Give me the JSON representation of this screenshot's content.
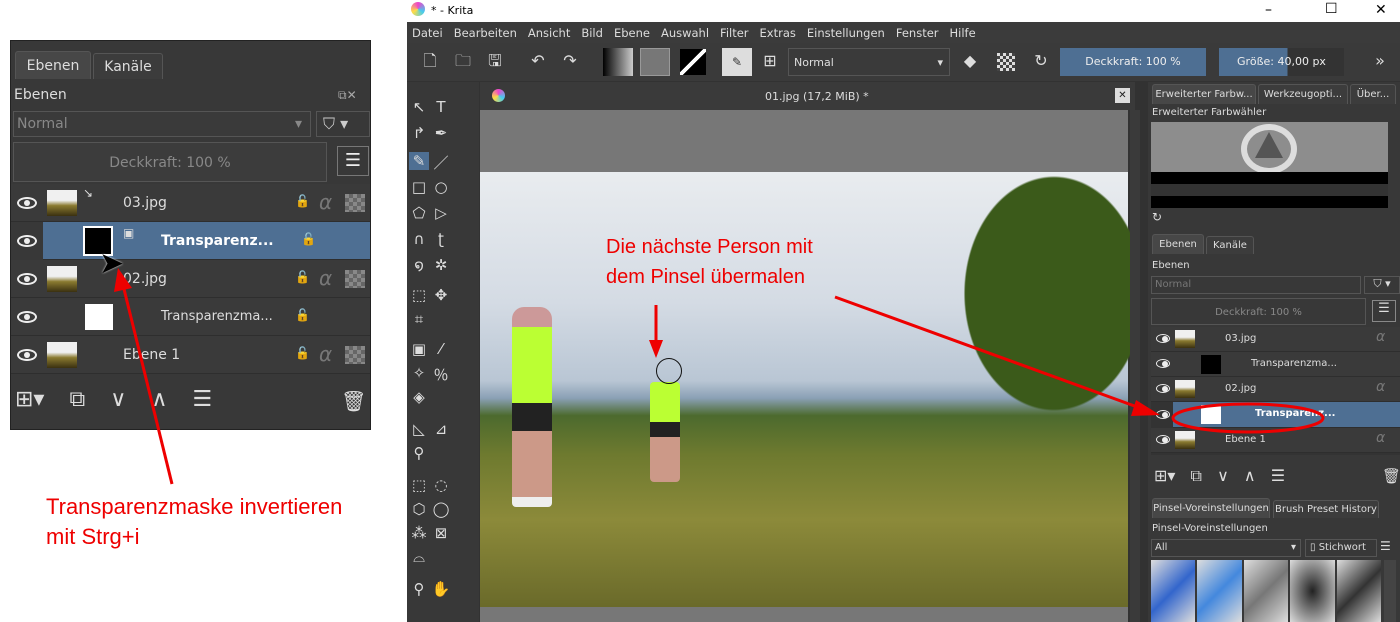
{
  "left_panel": {
    "tabs": [
      "Ebenen",
      "Kanäle"
    ],
    "title": "Ebenen",
    "blend_mode": "Normal",
    "opacity": "Deckkraft:  100 %",
    "layers": [
      {
        "name": "03.jpg",
        "selected": false
      },
      {
        "name": "Transparenz...",
        "selected": true
      },
      {
        "name": "02.jpg",
        "selected": false
      },
      {
        "name": "Transparenzma...",
        "selected": false
      },
      {
        "name": "Ebene 1",
        "selected": false
      }
    ]
  },
  "annotation_left": {
    "line1": "Transparenzmaske invertieren",
    "line2": "mit Strg+i"
  },
  "window": {
    "title": "* - Krita",
    "controls": [
      "–",
      "☐",
      "✕"
    ]
  },
  "menu": [
    "Datei",
    "Bearbeiten",
    "Ansicht",
    "Bild",
    "Ebene",
    "Auswahl",
    "Filter",
    "Extras",
    "Einstellungen",
    "Fenster",
    "Hilfe"
  ],
  "toolbar": {
    "blend_mode": "Normal",
    "opacity": "Deckkraft: 100 %",
    "size": "Größe: 40,00 px"
  },
  "canvas": {
    "doc_title": "01.jpg (17,2 MiB) *",
    "annotation_line1": "Die nächste Person mit",
    "annotation_line2": "dem Pinsel übermalen"
  },
  "right": {
    "top_tabs": [
      "Erweiterter Farbw...",
      "Werkzeugopti...",
      "Über..."
    ],
    "color_title": "Erweiterter Farbwähler",
    "layer_tabs": [
      "Ebenen",
      "Kanäle"
    ],
    "layers_title": "Ebenen",
    "blend_mode": "Normal",
    "opacity": "Deckkraft:  100 %",
    "layers": [
      {
        "name": "03.jpg",
        "selected": false
      },
      {
        "name": "Transparenzma...",
        "selected": false
      },
      {
        "name": "02.jpg",
        "selected": false
      },
      {
        "name": "Transparenz...",
        "selected": true
      },
      {
        "name": "Ebene 1",
        "selected": false
      }
    ],
    "brush_tabs": [
      "Pinsel-Voreinstellungen",
      "Brush Preset History"
    ],
    "brush_title": "Pinsel-Voreinstellungen",
    "brush_filter": "All",
    "tag_button": "Stichwort"
  },
  "colors": {
    "accent": "#4e6f93",
    "annotation": "#e00000",
    "bg": "#383838"
  }
}
